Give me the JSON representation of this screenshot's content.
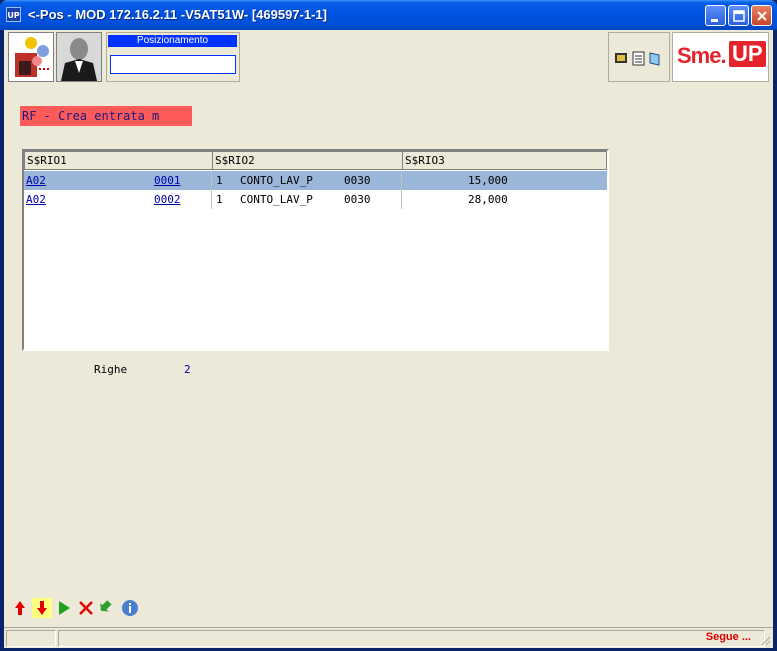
{
  "window": {
    "app_icon": "UP",
    "title": "<-Pos -  MOD 172.16.2.11 -V5AT51W- [469597-1-1]"
  },
  "toolbar": {
    "position_label": "Posizionamento",
    "position_value": "",
    "logo_text": "Sme.",
    "logo_badge": "UP"
  },
  "form": {
    "header_label": "RF - Crea entrata m"
  },
  "grid": {
    "columns": [
      "S$RIO1",
      "S$RIO2",
      "S$RIO3"
    ],
    "rows": [
      {
        "code": "A02",
        "num": "0001",
        "qty": "1",
        "desc": "CONTO_LAV_P",
        "op": "0030",
        "value": "15,000",
        "selected": true
      },
      {
        "code": "A02",
        "num": "0002",
        "qty": "1",
        "desc": "CONTO_LAV_P",
        "op": "0030",
        "value": "28,000",
        "selected": false
      }
    ]
  },
  "summary": {
    "rows_label": "Righe",
    "rows_count": "2"
  },
  "status": {
    "next_label": "Segue ..."
  },
  "colors": {
    "title_bar": "#0054e3",
    "selection": "#9ab7d9",
    "header_label_bg": "#ff5a5a",
    "logo_red": "#e5232b"
  }
}
